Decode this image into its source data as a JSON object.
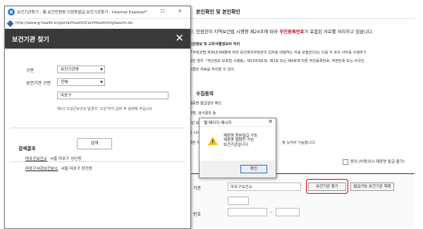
{
  "background": {
    "section_title": "본인확인 및 본인확인",
    "notice": {
      "prefix": "단, 민원인이 지역보건법 시행령 제24조에 따라 ",
      "highlight": "주민등록번호",
      "suffix": "가 포함된 자료를 처리하고 있습니다."
    },
    "legal_lines": [
      "민감정보 및 고유식별정보의 처리",
      "「부장관법 제30조제4항에 따라 보건복지부장관의 업무를 대행하는 자를 포함한다)는 다음 각 호의 사무를 수행하기",
      "피한 경우「개인정보 보호법 시행령」제19조제1호, 제2호 또는 제4호에 따른 주민등록번호, 여권번호 또는 외국인",
      "포함된 자료를 처리할 수 있다."
    ],
    "collect_heading": "수집동의",
    "collect_lines": [
      "제증명 발급결과 확인",
      "성명, 검사결과 등",
      "1년 또는",
      "급 시에만",
      "제한 아동은",
      "및 있어야 가능합니다."
    ],
    "agree_label": "동의 (비동의시 제증명 발급 불가)",
    "form": {
      "label_org": "기관",
      "org_value": "마포구보건소",
      "find_button": "보건기관 찾기",
      "list_button": "발급가능 보건기관 목록",
      "label_phone": "번호",
      "phone_separator": "-"
    }
  },
  "popup": {
    "window_title": "보건기관찾기 - 통·보건민원맞·지원증발급·보건기관찾기 - Internet Explorer",
    "window_controls": "─ ☐ ✕",
    "url": "http://www.g-health.kr/portal/health/CertiHealthOrgSearch.do",
    "header_title": "보건기관 찾기",
    "close_label": "✕",
    "fields": {
      "region_label": "구분",
      "region_value": "보건기관명",
      "type_label": "보건기관 구분",
      "type_value": "전체",
      "search_value": "마포구",
      "hint": "예시)'고성군보건소'일경우 '고성'까지 입력 후 검색해 주십시오"
    },
    "search_button": "검색",
    "results_heading": "검색결과",
    "results": [
      {
        "name": "마포구보건소",
        "address": "서울 마포구 성산동"
      },
      {
        "name": "마포구서강보건분소",
        "address": "서울 마포구 창전동"
      }
    ]
  },
  "dialog": {
    "title": "웹 페이지 메시지",
    "close_label": "✕",
    "message_lines": [
      "제증명 원본발급 가능",
      "제증명 열람만 가능",
      "보건기관입니다."
    ],
    "ok_button": "확인"
  }
}
